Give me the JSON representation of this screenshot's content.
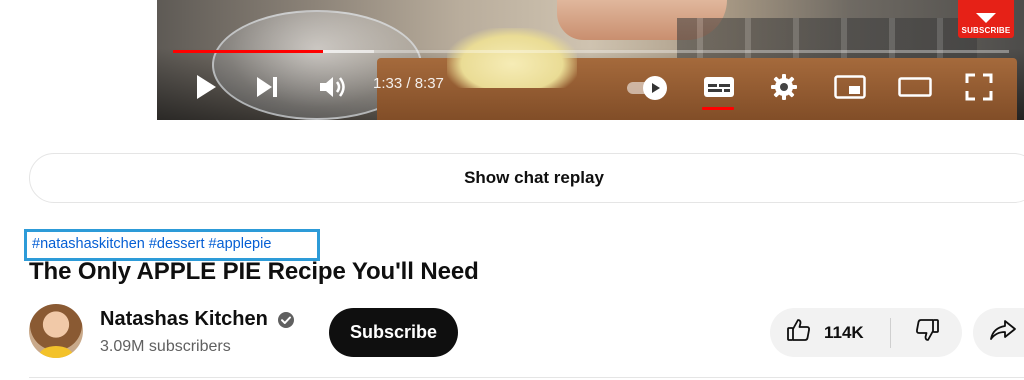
{
  "player": {
    "time_current": "1:33",
    "time_total": "8:37",
    "time_display": "1:33 / 8:37",
    "progress_played_fraction": 0.18,
    "progress_buffered_fraction": 0.24,
    "watermark_label": "SUBSCRIBE",
    "captions_enabled": true,
    "autoplay_on": true,
    "accent_color": "#ff0000",
    "icons": [
      "play-icon",
      "next-icon",
      "volume-icon",
      "autoplay-toggle",
      "captions-icon",
      "settings-icon",
      "miniplayer-icon",
      "theater-mode-icon",
      "fullscreen-icon"
    ]
  },
  "chat": {
    "replay_label": "Show chat replay"
  },
  "video": {
    "hashtags": [
      "#natashaskitchen",
      "#dessert",
      "#applepie"
    ],
    "title": "The Only APPLE PIE Recipe You'll Need"
  },
  "channel": {
    "name": "Natashas Kitchen",
    "verified": true,
    "subscribers": "3.09M subscribers",
    "subscribe_label": "Subscribe"
  },
  "actions": {
    "like_count": "114K",
    "link_color": "#065fd4",
    "highlight_color": "#2d9bd8"
  }
}
